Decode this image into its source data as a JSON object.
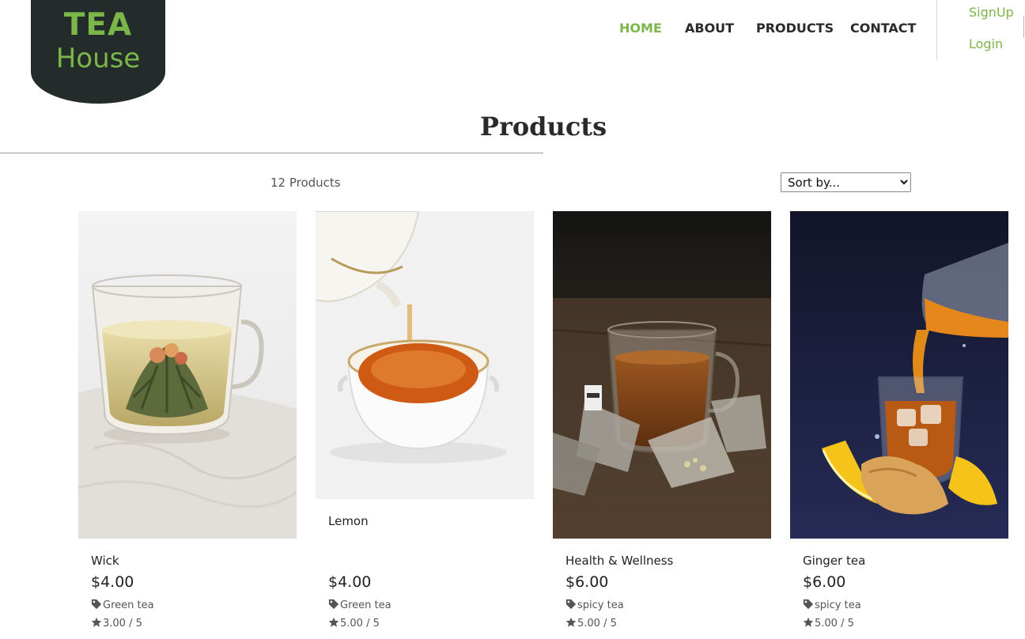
{
  "logo": {
    "line1": "TEA",
    "line2": "House",
    "bg_color": "#232b2b",
    "text_color": "#7ab648"
  },
  "nav": {
    "home": "HOME",
    "about": "ABOUT",
    "products": "PRODUCTS",
    "contact": "CONTACT",
    "active": "home",
    "active_color": "#7ab648"
  },
  "auth": {
    "signup": "SignUp",
    "login": "Login"
  },
  "page": {
    "title": "Products",
    "count": "12 Products",
    "sort_placeholder": "Sort by..."
  },
  "products": [
    {
      "name": "Wick",
      "price": "$4.00",
      "category": "Green tea",
      "rating": "3.00 / 5",
      "image": "glass cup of blooming green tea"
    },
    {
      "name": "Lemon",
      "price": "$4.00",
      "category": "Green tea",
      "rating": "5.00 / 5",
      "image": "tea poured from white teapot into bowl"
    },
    {
      "name": "Health & Wellness",
      "price": "$6.00",
      "category": "spicy tea",
      "rating": "5.00 / 5",
      "image": "glass of tea with tea bags on wooden table"
    },
    {
      "name": "Ginger tea",
      "price": "$6.00",
      "category": "spicy tea",
      "rating": "5.00 / 5",
      "image": "tea poured over ice with lemon and ginger"
    }
  ]
}
